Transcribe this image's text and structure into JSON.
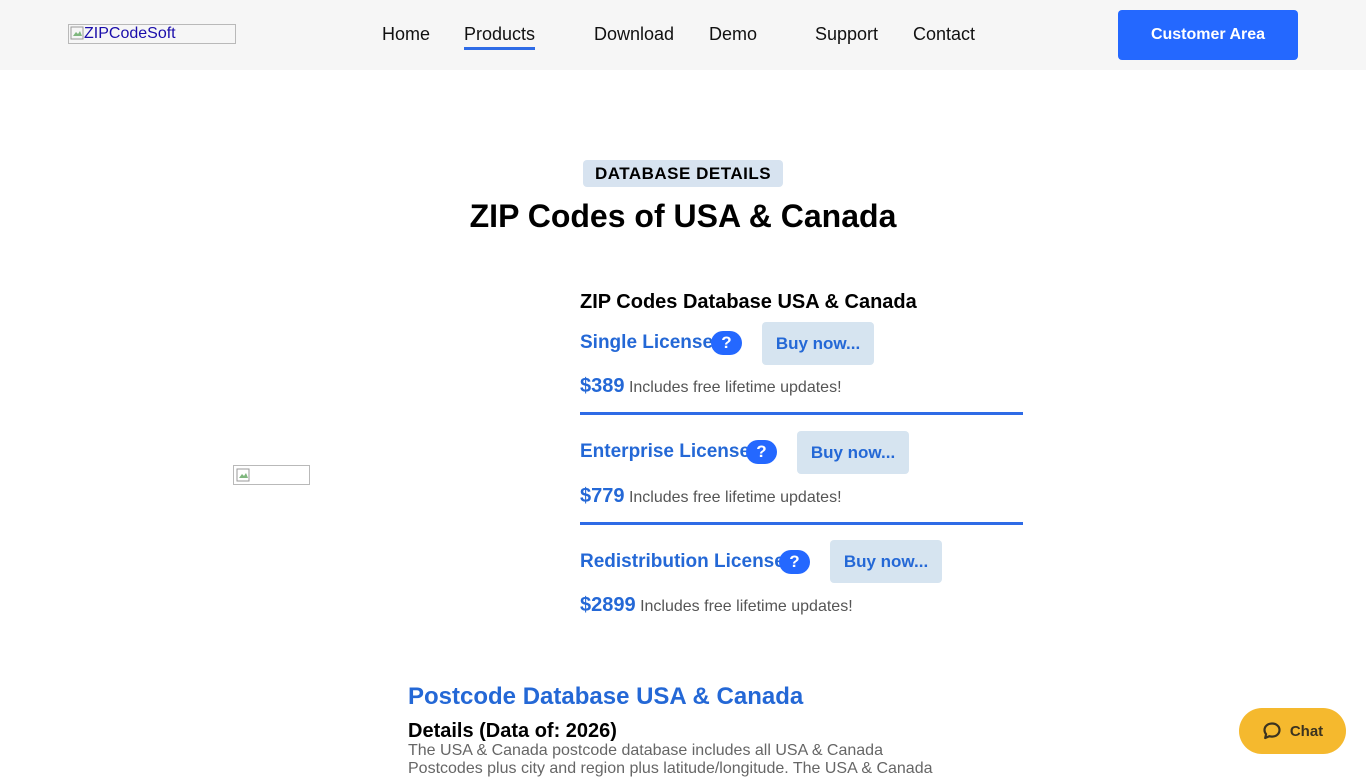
{
  "header": {
    "logo_alt": "ZIPCodeSoft",
    "nav": [
      {
        "label": "Home"
      },
      {
        "label": "Products"
      },
      {
        "label": "Download"
      },
      {
        "label": "Demo"
      },
      {
        "label": "Support"
      },
      {
        "label": "Contact"
      }
    ],
    "active_nav": "Products",
    "customer_area_label": "Customer Area"
  },
  "hero": {
    "badge": "DATABASE DETAILS",
    "title": "ZIP Codes of USA & Canada"
  },
  "product": {
    "heading": "ZIP Codes Database USA & Canada",
    "licenses": [
      {
        "name": "Single License",
        "help": "?",
        "buy_label": "Buy now...",
        "price": "$389",
        "note": "Includes free lifetime updates!"
      },
      {
        "name": "Enterprise License",
        "help": "?",
        "buy_label": "Buy now...",
        "price": "$779",
        "note": "Includes free lifetime updates!"
      },
      {
        "name": "Redistribution License",
        "help": "?",
        "buy_label": "Buy now...",
        "price": "$2899",
        "note": "Includes free lifetime updates!"
      }
    ]
  },
  "section": {
    "title": "Postcode Database USA & Canada",
    "details_title": "Details (Data of: 2026)",
    "details_text": "The USA & Canada postcode database includes all USA & Canada Postcodes plus city and region plus latitude/longitude. The USA & Canada"
  },
  "chat": {
    "label": "Chat",
    "icon": "chat-bubble-icon"
  },
  "colors": {
    "accent": "#2468ff",
    "link_blue": "#2468d6",
    "badge_bg": "#d7e3f0",
    "chat_bg": "#f5b92e",
    "topbar_bg": "#f6f6f6"
  }
}
